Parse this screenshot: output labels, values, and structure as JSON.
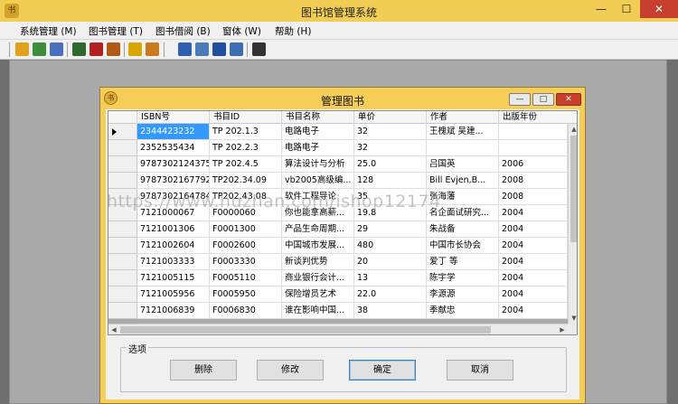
{
  "window": {
    "title": "图书馆管理系统",
    "app_icon_char": "书",
    "min": "—",
    "max": "☐",
    "close": "✕"
  },
  "menu": [
    {
      "label": "系统管理 (M)"
    },
    {
      "label": "图书管理 (T)"
    },
    {
      "label": "图书借阅 (B)"
    },
    {
      "label": "窗体 (W)"
    },
    {
      "label": "帮助 (H)"
    }
  ],
  "toolbar": {
    "icons": [
      "key-icon",
      "users-icon",
      "user-group-icon",
      "notebook-icon",
      "book-red-icon",
      "books-icon",
      "bulb-icon",
      "card-icon",
      "edit-book-icon",
      "monitor-icon",
      "blue-book-icon",
      "window-icon",
      "pointer-help-icon"
    ],
    "colors": [
      "#e0a21c",
      "#3c8e3c",
      "#4a6fbf",
      "#2d6a2d",
      "#b32020",
      "#b05a16",
      "#d9a600",
      "#c97a1a",
      "#2f5fae",
      "#4d7ab8",
      "#1f4f9e",
      "#3b6fb0",
      "#333333"
    ]
  },
  "dialog": {
    "title": "管理图书",
    "icon_char": "书",
    "min": "—",
    "max": "□",
    "close": "✕"
  },
  "grid": {
    "columns": [
      "ISBN号",
      "书目ID",
      "书目名称",
      "单价",
      "作者",
      "出版年份"
    ],
    "rows": [
      [
        "2344423232",
        "TP 202.1.3",
        "电路电子",
        "32",
        "王槐斌  吴建...",
        ""
      ],
      [
        "2352535434",
        "TP 202.2.3",
        "电路电子",
        "32",
        "",
        ""
      ],
      [
        "9787302124375",
        "TP 202.4.5",
        "算法设计与分析",
        "25.0",
        "吕国英",
        "2006"
      ],
      [
        "9787302167792",
        "TP202.34.09",
        "vb2005高级编...",
        "128",
        "Bill Evjen,B...",
        "2008"
      ],
      [
        "9787302164784",
        "TP202.43.08",
        "软件工程导论",
        "35",
        "张海藩",
        "2008"
      ],
      [
        "7121000067",
        "F0000060",
        "你也能拿高薪...",
        "19.8",
        "名企面试研究...",
        "2004"
      ],
      [
        "7121001306",
        "F0001300",
        "产品生命周期...",
        "29",
        "朱战备",
        "2004"
      ],
      [
        "7121002604",
        "F0002600",
        "中国城市发展...",
        "480",
        "中国市长协会",
        "2004"
      ],
      [
        "7121003333",
        "F0003330",
        "新谈判优势",
        "20",
        "爱丁  等",
        "2004"
      ],
      [
        "7121005115",
        "F0005110",
        "商业银行会计...",
        "13",
        "陈宇学",
        "2004"
      ],
      [
        "7121005956",
        "F0005950",
        "保险增员艺术",
        "22.0",
        "李源源",
        "2004"
      ],
      [
        "7121006839",
        "F0006830",
        "谁在影响中国...",
        "38",
        "季献忠",
        "2004"
      ]
    ],
    "selected_row": 0
  },
  "options": {
    "legend": "选项",
    "buttons": [
      "删除",
      "修改",
      "确定",
      "取消"
    ]
  },
  "watermark": "https://www.huzhan.com/ishop12174"
}
